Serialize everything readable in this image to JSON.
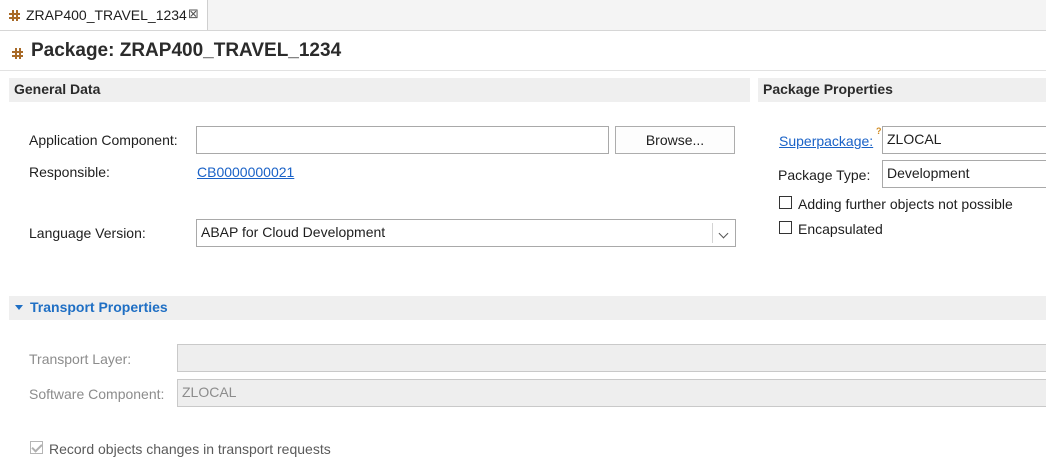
{
  "tab": {
    "label": "ZRAP400_TRAVEL_1234",
    "close_glyph": "⊠"
  },
  "header": {
    "title": "Package: ZRAP400_TRAVEL_1234"
  },
  "general": {
    "section_title": "General Data",
    "application_component": {
      "label": "Application Component:",
      "value": ""
    },
    "browse_label": "Browse...",
    "responsible": {
      "label": "Responsible:",
      "value": "CB0000000021"
    },
    "language_version": {
      "label": "Language Version:",
      "value": "ABAP for Cloud Development"
    }
  },
  "properties": {
    "section_title": "Package Properties",
    "superpackage": {
      "label": "Superpackage:",
      "value": "ZLOCAL"
    },
    "package_type": {
      "label": "Package Type:",
      "value": "Development"
    },
    "adding_further": {
      "label": "Adding further objects not possible",
      "checked": false
    },
    "encapsulated": {
      "label": "Encapsulated",
      "checked": false
    }
  },
  "transport": {
    "section_title": "Transport Properties",
    "layer": {
      "label": "Transport Layer:",
      "value": ""
    },
    "software_component": {
      "label": "Software Component:",
      "value": "ZLOCAL"
    },
    "record_changes": {
      "label": "Record objects changes in transport requests",
      "checked": true
    }
  },
  "colors": {
    "link": "#1a62c7",
    "section_bg": "#efefef",
    "package_icon": "#a86a28"
  },
  "icons": [
    "package-icon",
    "close-icon",
    "chevron-down-icon",
    "collapse-triangle-icon",
    "checkmark-icon"
  ]
}
